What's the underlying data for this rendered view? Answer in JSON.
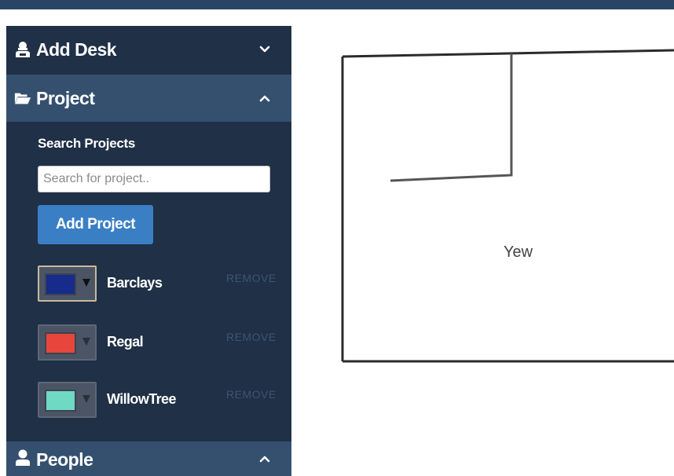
{
  "sidebar": {
    "add_desk": {
      "label": "Add Desk",
      "icon": "user-icon",
      "chevron": "chevron-down-icon"
    },
    "project": {
      "label": "Project",
      "icon": "folder-open-icon",
      "chevron": "chevron-up-icon"
    },
    "people": {
      "label": "People",
      "icon": "person-icon",
      "chevron": "chevron-up-icon"
    }
  },
  "project_panel": {
    "search_title": "Search Projects",
    "search_placeholder": "Search for project..",
    "search_value": "",
    "add_button": "Add Project",
    "projects": [
      {
        "name": "Barclays",
        "color": "#162b8c",
        "remove_label": "REMOVE"
      },
      {
        "name": "Regal",
        "color": "#e8453c",
        "remove_label": "REMOVE"
      },
      {
        "name": "WillowTree",
        "color": "#6fd9c3",
        "remove_label": "REMOVE"
      }
    ]
  },
  "floorplan": {
    "room_label": "Yew"
  },
  "colors": {
    "topbar": "#2a4563",
    "sidebar_bg": "#1f3047",
    "section_header_bg": "#35506f",
    "button_blue": "#3a7fc4"
  }
}
